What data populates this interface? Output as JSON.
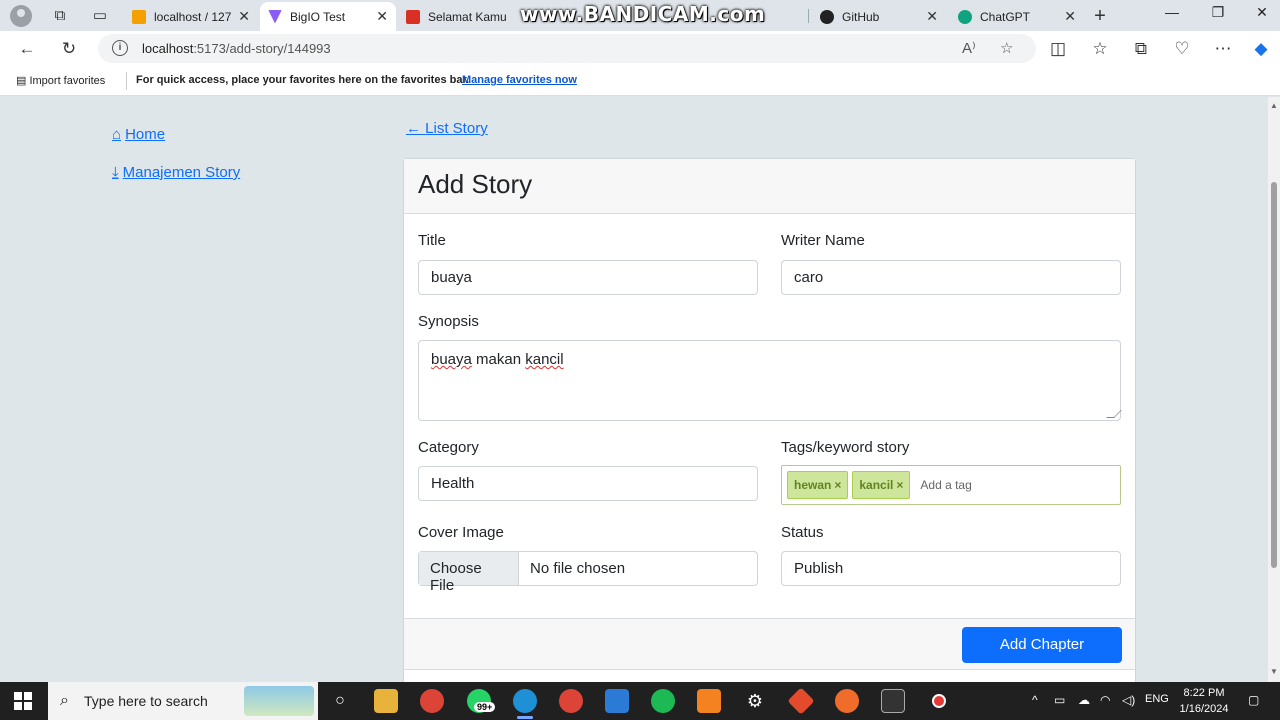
{
  "browser": {
    "tabs": [
      {
        "label": "localhost / 127.",
        "favicon_color": "#f4a000"
      },
      {
        "label": "BigIO Test",
        "favicon_color": "#8b5cf6"
      },
      {
        "label": "Selamat Kamu",
        "favicon_color": "#d93025"
      },
      {
        "label": "GitHub",
        "favicon_color": "#222222"
      },
      {
        "label": "ChatGPT",
        "favicon_color": "#10a37f"
      }
    ],
    "watermark": "www.BANDICAM.com",
    "url_host": "localhost",
    "url_path": ":5173/add-story/144993",
    "favorites": {
      "import": "Import favorites",
      "hint": "For quick access, place your favorites here on the favorites bar.",
      "manage": "Manage favorites now"
    }
  },
  "sidebar": {
    "items": [
      {
        "label": "Home",
        "icon": "home-icon"
      },
      {
        "label": "Manajemen Story",
        "icon": "download-icon"
      }
    ]
  },
  "back_link": "List Story",
  "form": {
    "heading": "Add Story",
    "title_label": "Title",
    "title_value": "buaya",
    "writer_label": "Writer Name",
    "writer_value": "caro",
    "synopsis_label": "Synopsis",
    "synopsis_value": "buaya makan kancil",
    "synopsis_words": [
      "buaya",
      "makan",
      "kancil"
    ],
    "category_label": "Category",
    "category_value": "Health",
    "tags_label": "Tags/keyword story",
    "tags": [
      "hewan",
      "kancil"
    ],
    "tag_remove": "×",
    "tag_placeholder": "Add a tag",
    "cover_label": "Cover Image",
    "choose_file": "Choose File",
    "no_file": "No file chosen",
    "status_label": "Status",
    "status_value": "Publish",
    "add_chapter": "Add Chapter"
  },
  "taskbar": {
    "search_placeholder": "Type here to search",
    "notification_badge": "99+",
    "language": "ENG",
    "time": "8:22 PM",
    "date": "1/16/2024"
  },
  "colors": {
    "primary": "#0d6efd",
    "tag_bg": "#cde69c",
    "tag_text": "#638421",
    "page_bg": "#dfe6e9"
  }
}
